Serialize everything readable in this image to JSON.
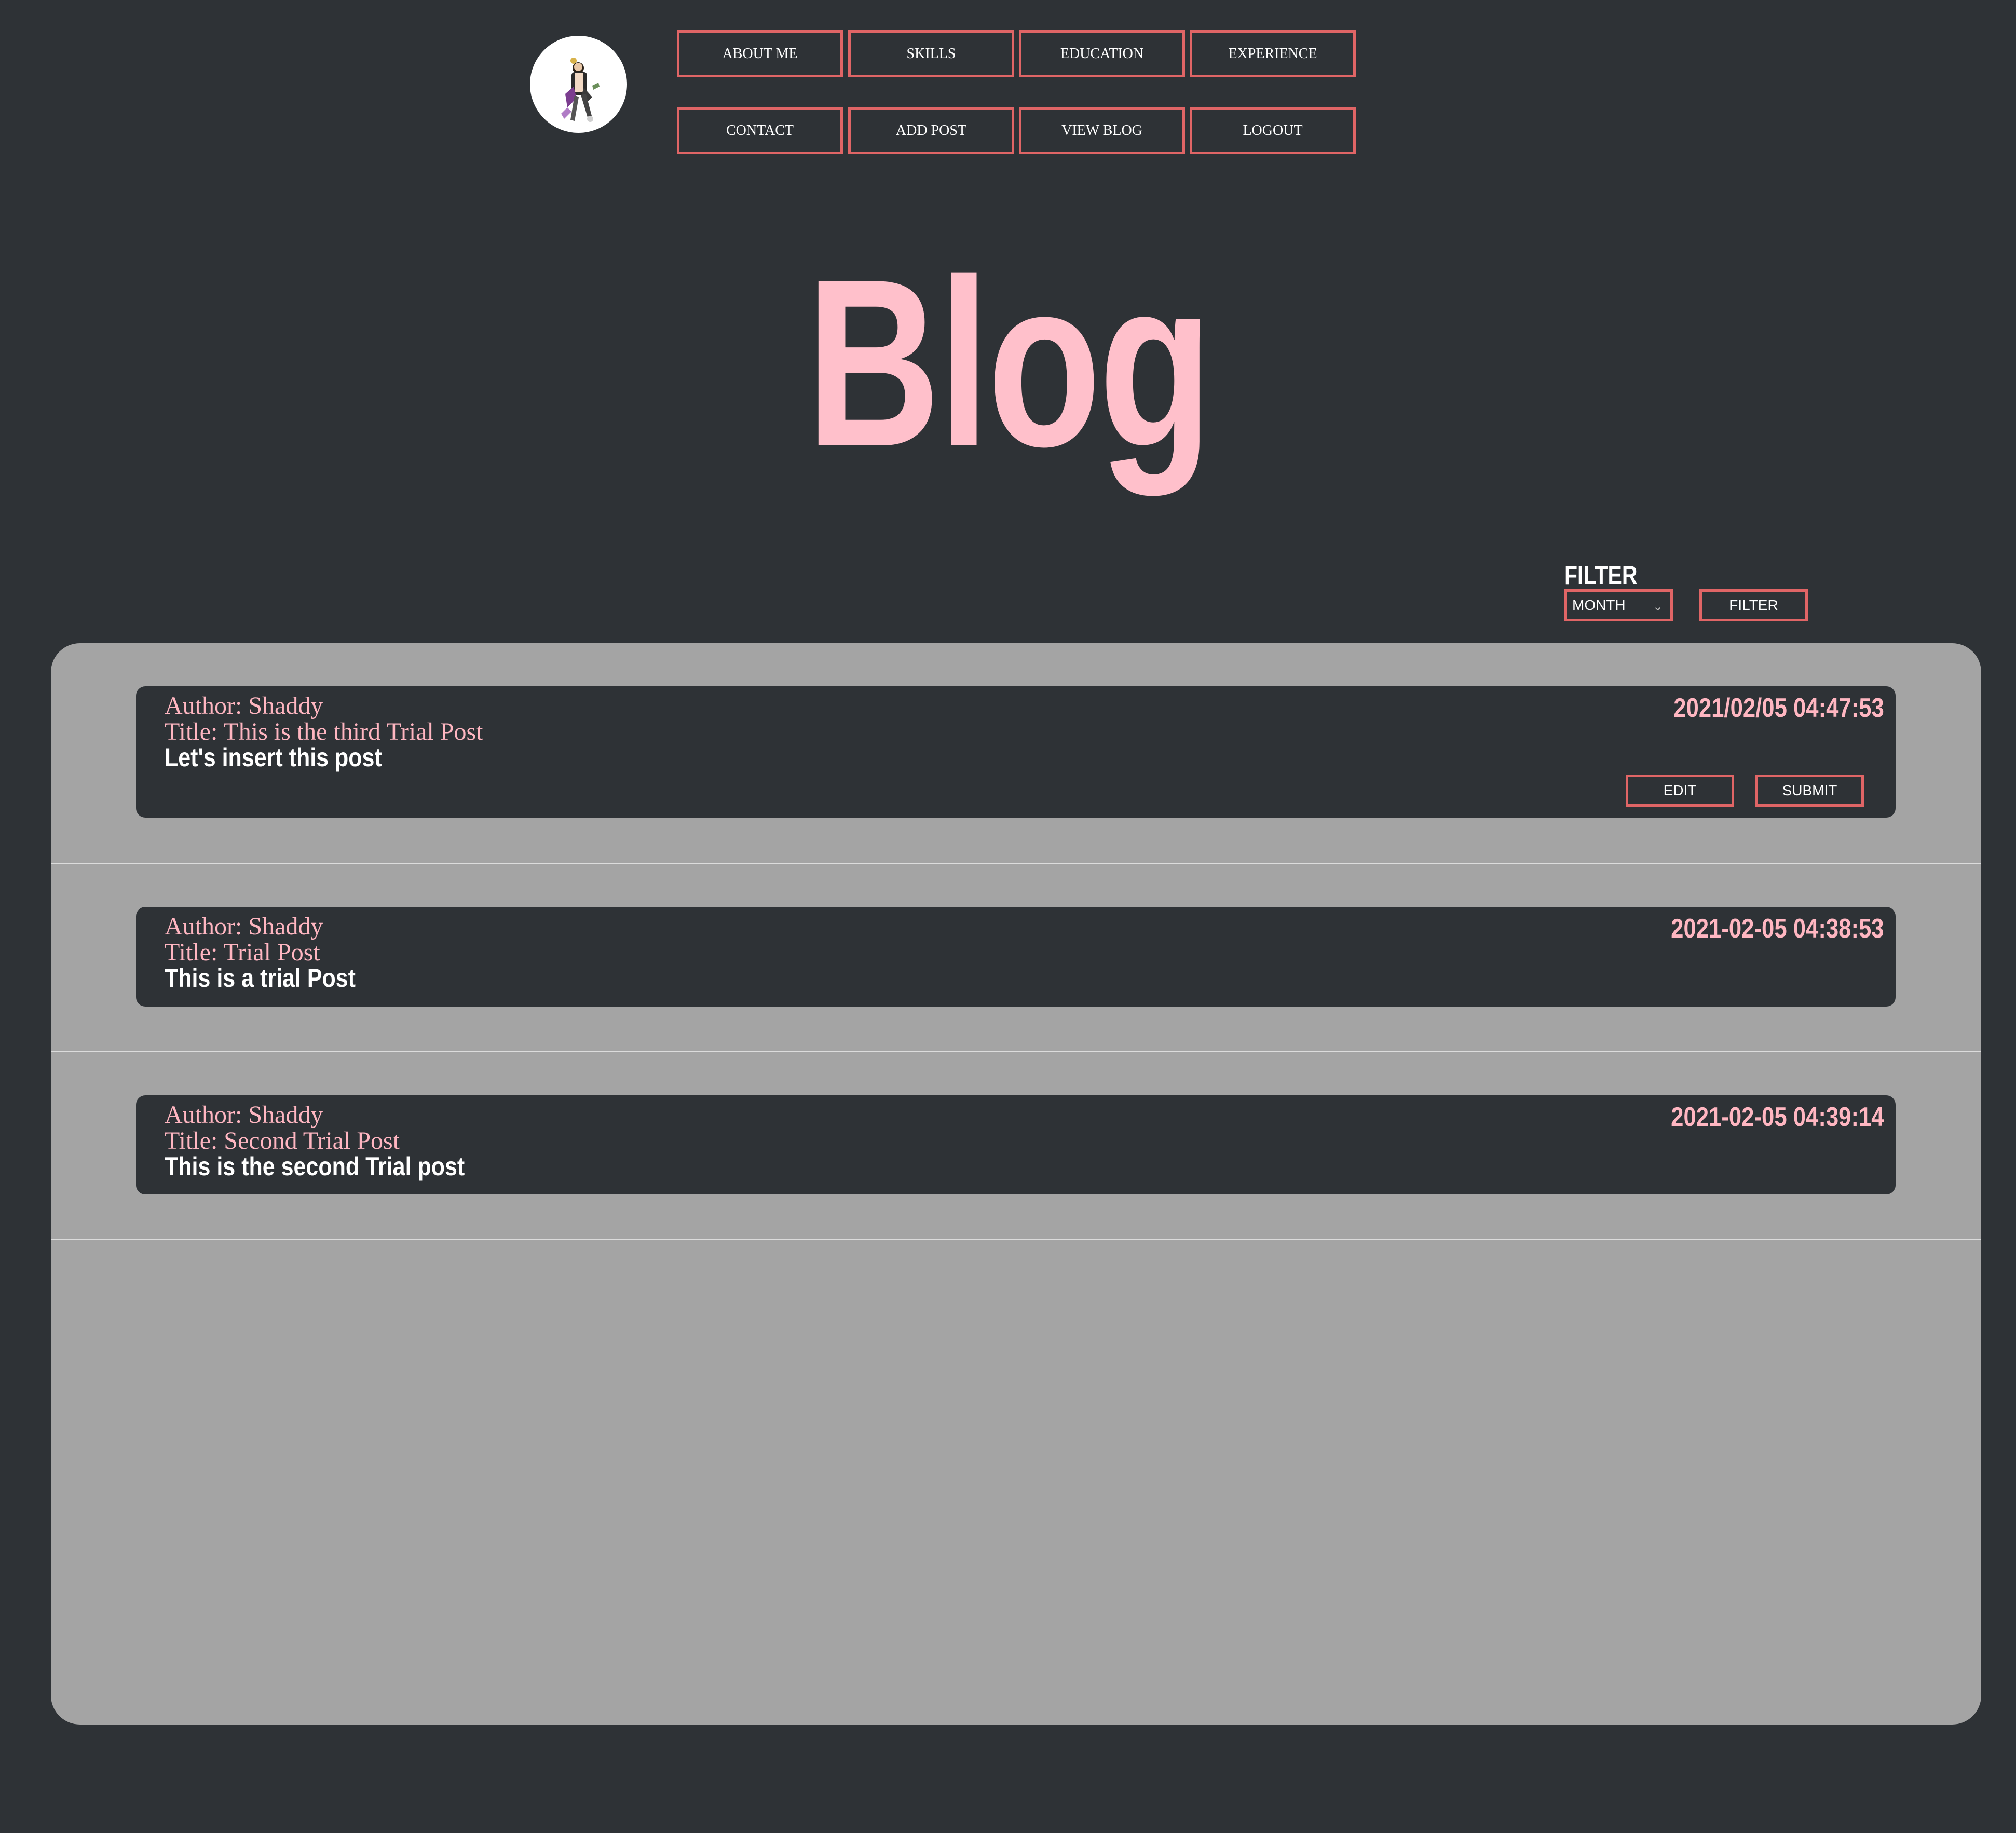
{
  "header": {
    "logo_icon": "avatar-cartoon-icon",
    "nav_row1": [
      "ABOUT ME",
      "SKILLS",
      "EDUCATION",
      "EXPERIENCE"
    ],
    "nav_row2": [
      "CONTACT",
      "ADD POST",
      "VIEW BLOG",
      "LOGOUT"
    ]
  },
  "page": {
    "title": "Blog"
  },
  "filter": {
    "label": "FILTER",
    "select_value": "MONTH",
    "button_label": "FILTER"
  },
  "posts": [
    {
      "author": "Author: Shaddy",
      "title": "Title: This is the third Trial Post",
      "body": "Let's insert this post",
      "timestamp": "2021/02/05 04:47:53",
      "edit_label": "EDIT",
      "submit_label": "SUBMIT"
    },
    {
      "author": "Author: Shaddy",
      "title": "Title: Trial Post",
      "body": "This is a trial Post",
      "timestamp": "2021-02-05 04:38:53"
    },
    {
      "author": "Author: Shaddy",
      "title": "Title: Second Trial Post",
      "body": "This is the second Trial post",
      "timestamp": "2021-02-05 04:39:14"
    }
  ],
  "colors": {
    "background": "#2e3236",
    "accent_border": "#e06566",
    "pink_text": "#ffb6c1",
    "panel": "#a4a4a4"
  }
}
